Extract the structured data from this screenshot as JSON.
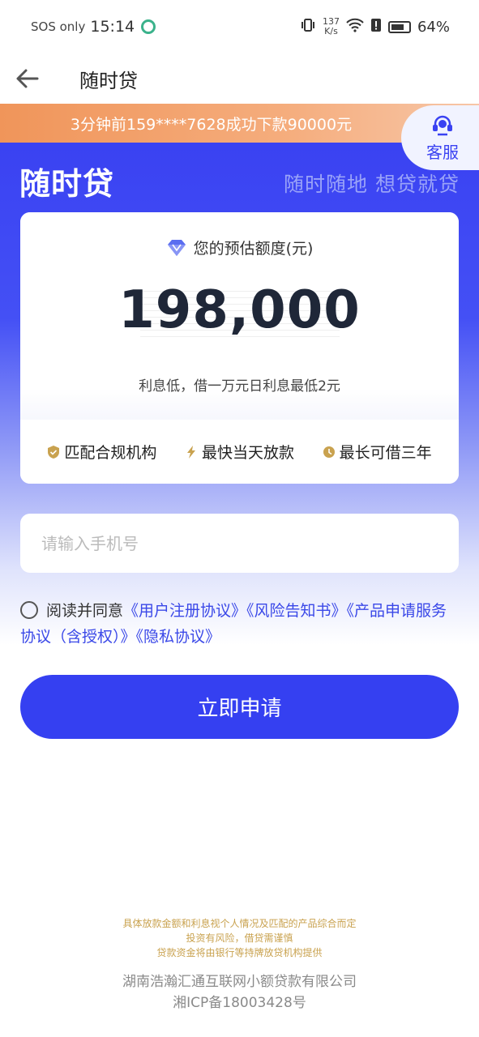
{
  "status_bar": {
    "carrier": "SOS only",
    "time": "15:14",
    "net_speed_value": "137",
    "net_speed_unit": "K/s",
    "battery": "64%"
  },
  "header": {
    "title": "随时贷"
  },
  "notice": {
    "text": "3分钟前159****7628成功下款90000元"
  },
  "service": {
    "label": "客服"
  },
  "brand": {
    "name": "随时贷",
    "slogan": "随时随地 想贷就贷"
  },
  "quota": {
    "title": "您的预估额度(元)",
    "amount": "198,000",
    "note": "利息低，借一万元日利息最低2元"
  },
  "features": [
    {
      "label": "匹配合规机构",
      "icon": "shield-icon"
    },
    {
      "label": "最快当天放款",
      "icon": "lightning-icon"
    },
    {
      "label": "最长可借三年",
      "icon": "clock-icon"
    }
  ],
  "phone": {
    "placeholder": "请输入手机号"
  },
  "agreement": {
    "prefix": "阅读并同意",
    "links": [
      "《用户注册协议》",
      "《风险告知书》",
      "《产品申请服务协议（含授权）》",
      "《隐私协议》"
    ]
  },
  "apply_button": "立即申请",
  "footer": {
    "disclaimer_lines": [
      "具体放款金额和利息视个人情况及匹配的产品综合而定",
      "投资有风险，借贷需谨慎",
      "贷款资金将由银行等持牌放贷机构提供"
    ],
    "company": "湖南浩瀚汇通互联网小额贷款有限公司",
    "icp": "湘ICP备18003428号"
  },
  "colors": {
    "primary": "#3540f1",
    "notice_orange": "#f0955a",
    "link_blue": "#3a48e8",
    "gold": "#c9a24f"
  }
}
